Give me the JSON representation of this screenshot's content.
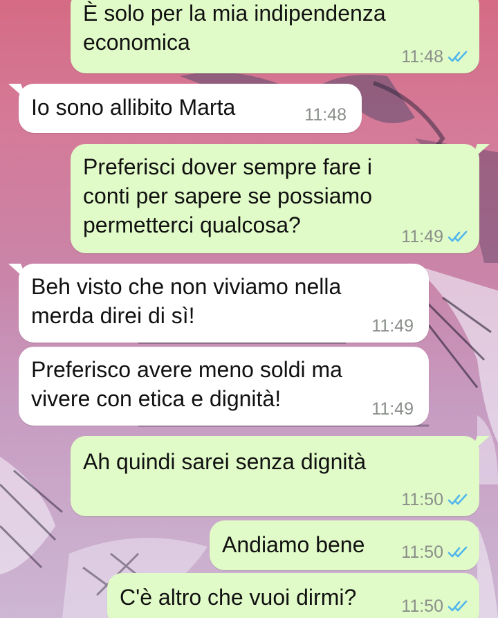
{
  "colors": {
    "outgoing_bubble": "#e1fbc8",
    "incoming_bubble": "#ffffff",
    "read_ticks": "#4fb6ec",
    "timestamp": "#8a8f8a"
  },
  "icons": {
    "read_receipt": "double-check-icon"
  },
  "messages": [
    {
      "direction": "out",
      "text": "È solo per la mia indipendenza\neconomica",
      "time": "11:48",
      "read": true
    },
    {
      "direction": "in",
      "text": "Io sono allibito Marta",
      "time": "11:48"
    },
    {
      "direction": "out",
      "text": "Preferisci dover sempre fare i\nconti per sapere se possiamo\npermetterci qualcosa?",
      "time": "11:49",
      "read": true
    },
    {
      "direction": "in",
      "text": "Beh visto che non viviamo nella\nmerda direi di sì!",
      "time": "11:49"
    },
    {
      "direction": "in",
      "text": "Preferisco avere meno soldi ma\nvivere con etica e dignità!",
      "time": "11:49"
    },
    {
      "direction": "out",
      "text": "Ah quindi sarei senza dignità",
      "time": "11:50",
      "read": true
    },
    {
      "direction": "out",
      "text": "Andiamo bene",
      "time": "11:50",
      "read": true
    },
    {
      "direction": "out",
      "text": "C'è altro che vuoi dirmi?",
      "time": "11:50",
      "read": true
    }
  ]
}
